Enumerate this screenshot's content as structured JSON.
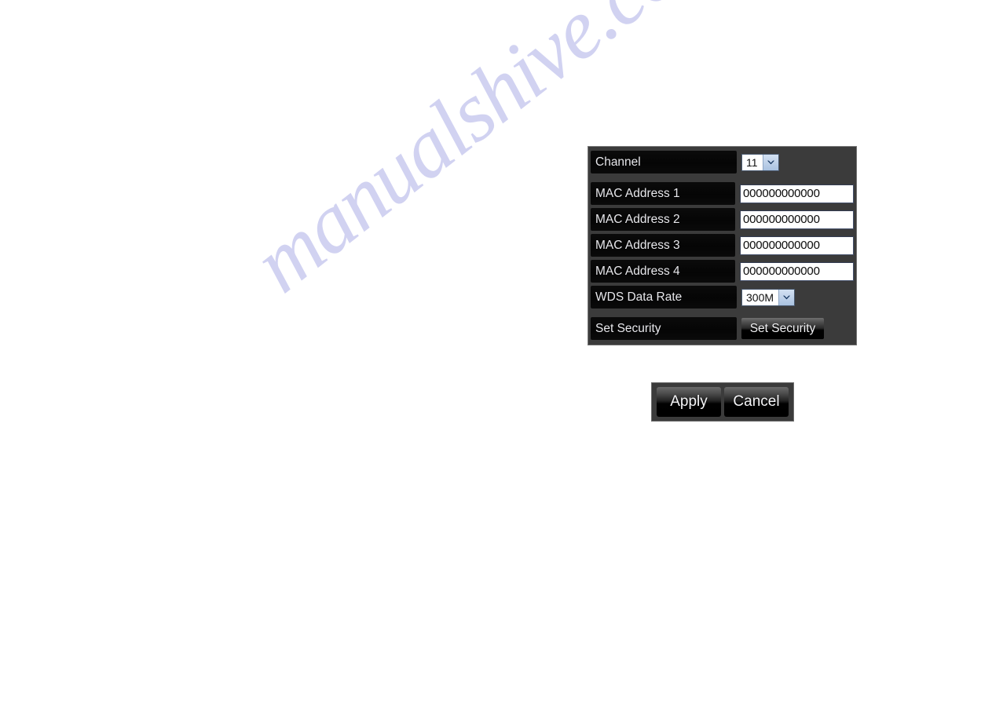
{
  "watermark": {
    "text": "manualshive.com",
    "color": "#c9cbef"
  },
  "panel": {
    "name": "wds-settings-panel",
    "background_color": "#3b3b3b",
    "rows": [
      {
        "id": "channel",
        "label": "Channel",
        "control": "select",
        "value": "11"
      },
      {
        "id": "mac-address-1",
        "label": "MAC Address 1",
        "control": "text",
        "value": "000000000000"
      },
      {
        "id": "mac-address-2",
        "label": "MAC Address 2",
        "control": "text",
        "value": "000000000000"
      },
      {
        "id": "mac-address-3",
        "label": "MAC Address 3",
        "control": "text",
        "value": "000000000000"
      },
      {
        "id": "mac-address-4",
        "label": "MAC Address 4",
        "control": "text",
        "value": "000000000000"
      },
      {
        "id": "wds-data-rate",
        "label": "WDS Data Rate",
        "control": "select",
        "value": "300M"
      },
      {
        "id": "set-security",
        "label": "Set Security",
        "control": "button",
        "value": "Set Security"
      }
    ]
  },
  "actions": {
    "apply_label": "Apply",
    "cancel_label": "Cancel"
  }
}
